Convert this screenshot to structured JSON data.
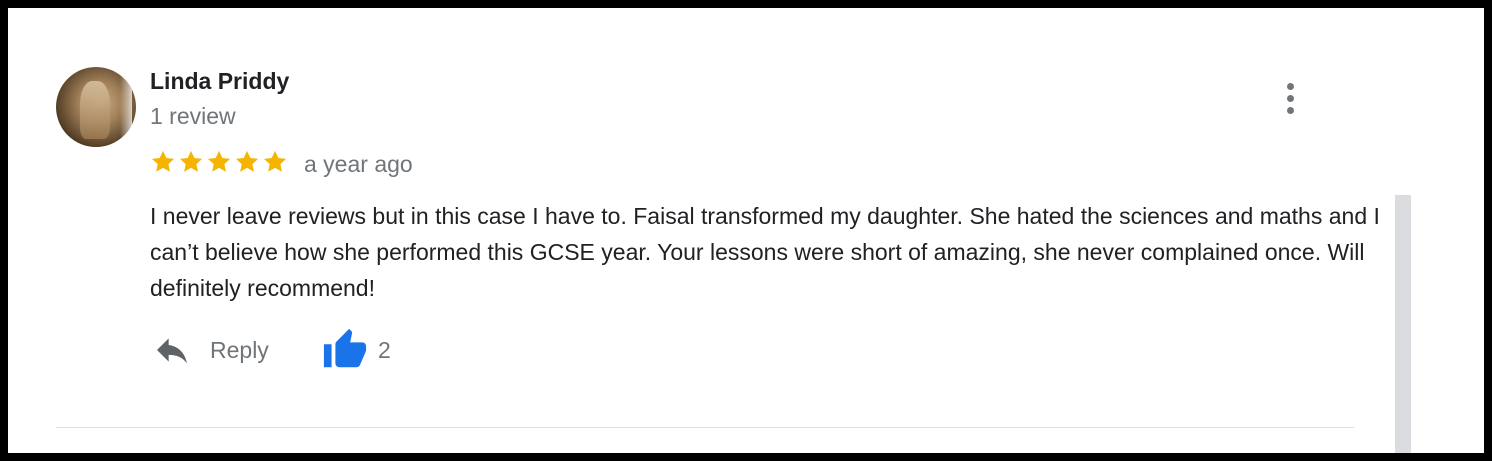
{
  "review": {
    "author": "Linda Priddy",
    "author_meta": "1 review",
    "rating": 5,
    "rating_max": 5,
    "time": "a year ago",
    "text": "I never leave reviews but in this case I have to. Faisal transformed my daughter. She hated the sciences and maths and I can’t believe how she performed this GCSE year. Your lessons were short of amazing, she never complained once. Will definitely recommend!",
    "reply_label": "Reply",
    "like_count": "2"
  },
  "icons": {
    "avatar": "user-avatar-photo",
    "menu": "more-vert-icon",
    "star": "star-icon",
    "reply": "reply-arrow-icon",
    "like": "thumbs-up-icon"
  },
  "colors": {
    "star": "#f4b400",
    "like": "#1a73e8",
    "secondary_text": "#70757a",
    "primary_text": "#202124"
  }
}
